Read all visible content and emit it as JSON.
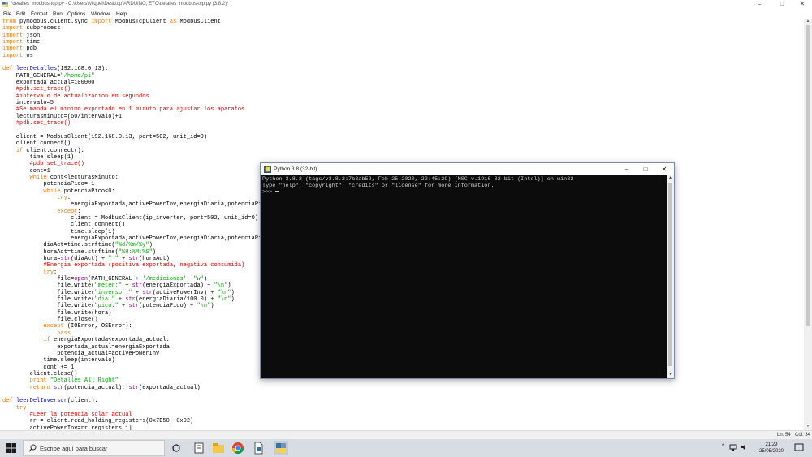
{
  "window": {
    "title": "*detalles_modbus-tcp.py - C:\\Users\\Miquel\\Desktop\\ARDUINO, ETC\\detalles_modbus-tcp.py (3.8.2)*",
    "minimize": "–",
    "maximize": "□",
    "close": "✕"
  },
  "menu": {
    "file": "File",
    "edit": "Edit",
    "format": "Format",
    "run": "Run",
    "options": "Options",
    "window": "Window",
    "help": "Help"
  },
  "code_lines": [
    "from pymodbus.client.sync import ModbusTcpClient as ModbusClient",
    "import subprocess",
    "import json",
    "import time",
    "import pdb",
    "import os",
    "",
    "def leerDetalles(192.168.0.13):",
    "    PATH_GENERAL=\"/home/pi\"",
    "    exportada_actual=100000",
    "    #pdb.set_trace()",
    "    #intervalo de actualizacion en segundos",
    "    intervalo=5",
    "    #Se manda el minimo exportado en 1 minuto para ajustar los aparatos",
    "    lecturasMinuto=(60/intervalo)+1",
    "    #pdb.set_trace()",
    "",
    "    client = ModbusClient(192.168.0.13, port=502, unit_id=0)",
    "    client.connect()",
    "    if client.connect():",
    "        time.sleep(1)",
    "        #pdb.set_trace()",
    "        cont=1",
    "        while cont<lecturasMinuto:",
    "            potenciaPico=-1",
    "            while potenciaPico<0:",
    "                try:",
    "                    energiaExportada,activePowerInv,energiaDiaria,potenciaPico",
    "                except:",
    "                    client = ModbusClient(ip_inverter, port=502, unit_id=0)",
    "                    client.connect()",
    "                    time.sleep(1)",
    "                    energiaExportada,activePowerInv,energiaDiaria,potenciaPic",
    "            diaAct=time.strftime(\"%d/%m/%y\")",
    "            horaAct=time.strftime(\"%H:%M:%S\")",
    "            hora=str(diaAct) + \" \" + str(horaAct)",
    "            #Energia exportada (positiva exportada, negativa consumida)",
    "            try:",
    "                file=open(PATH_GENERAL + '/mediciones', \"w\")",
    "                file.write(\"meter:\" + str(energiaExportada) + \"\\n\")",
    "                file.write(\"inversor:\" + str(activePowerInv) + \"\\n\")",
    "                file.write(\"dia:\" + str(energiaDiaria/100.0) + \"\\n\")",
    "                file.write(\"pico:\" + str(potenciaPico) + \"\\n\")",
    "                file.write(hora)",
    "                file.close()",
    "            except (IOError, OSError):",
    "                pass",
    "            if energiaExportada<exportada_actual:",
    "                exportada_actual=energiaExportada",
    "                potencia_actual=activePowerInv",
    "            time.sleep(intervalo)",
    "            cont += 1",
    "        client.close()",
    "        print \"Detalles All Right\"",
    "        return str(potencia_actual), str(exportada_actual)",
    "",
    "def leerDelInversor(client):",
    "    try:",
    "        #Leer la potencia solar actual",
    "        rr = client.read_holding_registers(0x7D50, 0x02)",
    "        activePowerInv=rr.registers[1]"
  ],
  "status": {
    "line": "Ln: 54",
    "col": "Col: 34"
  },
  "shell": {
    "title": "Python 3.8 (32-bit)",
    "line1": "Python 3.8.2 (tags/v3.8.2:7b3ab59, Feb 25 2020, 22:45:29) [MSC v.1916 32 bit (Intel)] on win32",
    "line2": "Type \"help\", \"copyright\", \"credits\" or \"license\" for more information.",
    "prompt": ">>> "
  },
  "taskbar": {
    "search_placeholder": "Escribe aquí para buscar",
    "time": "21:29",
    "date": "25/05/2020",
    "tray_chevron": "^"
  },
  "icons": {
    "python": "python-icon",
    "windows": "windows-logo-icon",
    "search": "search-icon",
    "task_view": "task-view-icon",
    "explorer": "folder-icon",
    "chrome": "chrome-icon",
    "notepad": "file-icon"
  },
  "colors": {
    "keyword": "#ff7700",
    "builtin": "#900090",
    "string": "#00aa00",
    "comment": "#dd0000",
    "definition": "#0000ff",
    "console_bg": "#0c0c0c",
    "console_fg": "#cccccc",
    "taskbar_bg": "#d8dde4"
  }
}
